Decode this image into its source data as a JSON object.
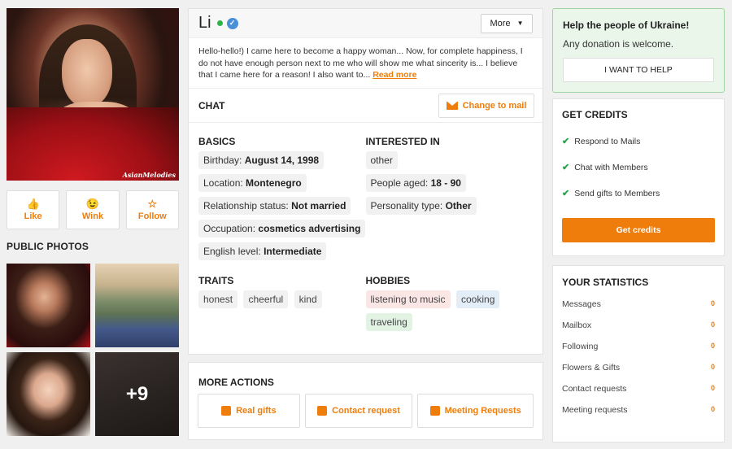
{
  "profile": {
    "name": "Li",
    "watermark": "AsianMelodies",
    "more_label": "More",
    "about_text": "Hello-hello!) I came here to become a happy woman... Now, for complete happiness, I do not have enough person next to me who will show me what sincerity is... I believe that I came here for a reason! I also want to...",
    "read_more": "Read more"
  },
  "actions": [
    {
      "label": "Like",
      "icon": "thumbs-up-icon"
    },
    {
      "label": "Wink",
      "icon": "wink-icon"
    },
    {
      "label": "Follow",
      "icon": "star-icon"
    }
  ],
  "public_photos": {
    "title": "PUBLIC PHOTOS",
    "more_count": "+9"
  },
  "chat": {
    "label": "CHAT",
    "change_label": "Change to mail"
  },
  "basics": {
    "title": "BASICS",
    "items": [
      {
        "label": "Birthday:",
        "value": "August 14, 1998"
      },
      {
        "label": "Location:",
        "value": "Montenegro"
      },
      {
        "label": "Relationship status:",
        "value": "Not married"
      },
      {
        "label": "Occupation:",
        "value": "cosmetics advertising"
      },
      {
        "label": "English level:",
        "value": "Intermediate"
      }
    ]
  },
  "interested": {
    "title": "INTERESTED IN",
    "gender": "other",
    "age_label": "People aged:",
    "age_value": "18 - 90",
    "personality_label": "Personality type:",
    "personality_value": "Other"
  },
  "traits": {
    "title": "TRAITS",
    "items": [
      "honest",
      "cheerful",
      "kind"
    ]
  },
  "hobbies": {
    "title": "HOBBIES",
    "items": [
      "listening to music",
      "cooking",
      "traveling"
    ]
  },
  "more_actions": {
    "title": "MORE ACTIONS",
    "buttons": [
      "Real gifts",
      "Contact request",
      "Meeting Requests"
    ]
  },
  "ukraine": {
    "title": "Help the people of Ukraine!",
    "text": "Any donation is welcome.",
    "button": "I WANT TO HELP"
  },
  "credits": {
    "title": "GET CREDITS",
    "items": [
      "Respond to Mails",
      "Chat with Members",
      "Send gifts to Members"
    ],
    "button": "Get credits"
  },
  "statistics": {
    "title": "YOUR STATISTICS",
    "items": [
      {
        "label": "Messages",
        "value": "0"
      },
      {
        "label": "Mailbox",
        "value": "0"
      },
      {
        "label": "Following",
        "value": "0"
      },
      {
        "label": "Flowers & Gifts",
        "value": "0"
      },
      {
        "label": "Contact requests",
        "value": "0"
      },
      {
        "label": "Meeting requests",
        "value": "0"
      }
    ]
  },
  "colors": {
    "accent": "#ef7d0b",
    "online": "#2db34a",
    "verified": "#4a90d9",
    "ukraine_bg": "#eaf6ea"
  }
}
